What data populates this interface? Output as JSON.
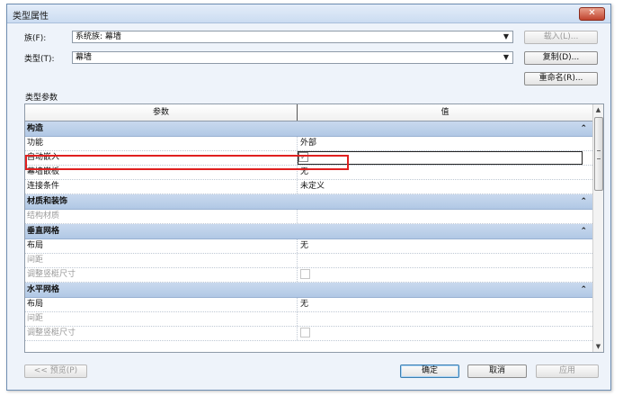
{
  "window": {
    "title": "类型属性",
    "close_glyph": "✕"
  },
  "family": {
    "label": "族(F):",
    "value": "系统族: 幕墙",
    "load_button": "载入(L)..."
  },
  "type": {
    "label": "类型(T):",
    "value": "幕墙",
    "duplicate_button": "复制(D)...",
    "rename_button": "重命名(R)..."
  },
  "type_params_label": "类型参数",
  "grid": {
    "headers": {
      "param": "参数",
      "value": "值"
    },
    "groups": [
      {
        "name": "构造",
        "rows": [
          {
            "param": "功能",
            "value": "外部"
          },
          {
            "param": "自动嵌入",
            "checkbox": true,
            "checked": true,
            "selected": true
          },
          {
            "param": "幕墙嵌板",
            "value": "无"
          },
          {
            "param": "连接条件",
            "value": "未定义"
          }
        ]
      },
      {
        "name": "材质和装饰",
        "rows": [
          {
            "param": "结构材质",
            "value": "",
            "disabled": true
          }
        ]
      },
      {
        "name": "垂直网格",
        "rows": [
          {
            "param": "布局",
            "value": "无"
          },
          {
            "param": "间距",
            "value": "",
            "disabled": true
          },
          {
            "param": "调整竖梃尺寸",
            "checkbox": true,
            "checked": false,
            "disabled": true
          }
        ]
      },
      {
        "name": "水平网格",
        "rows": [
          {
            "param": "布局",
            "value": "无"
          },
          {
            "param": "间距",
            "value": "",
            "disabled": true
          },
          {
            "param": "调整竖梃尺寸",
            "checkbox": true,
            "checked": false,
            "disabled": true
          }
        ]
      }
    ]
  },
  "footer": {
    "preview": "<< 预览(P)",
    "ok": "确定",
    "cancel": "取消",
    "apply": "应用"
  },
  "colors": {
    "group_header": "#b9cfe9",
    "highlight": "#e02020",
    "close": "#c0432e"
  }
}
